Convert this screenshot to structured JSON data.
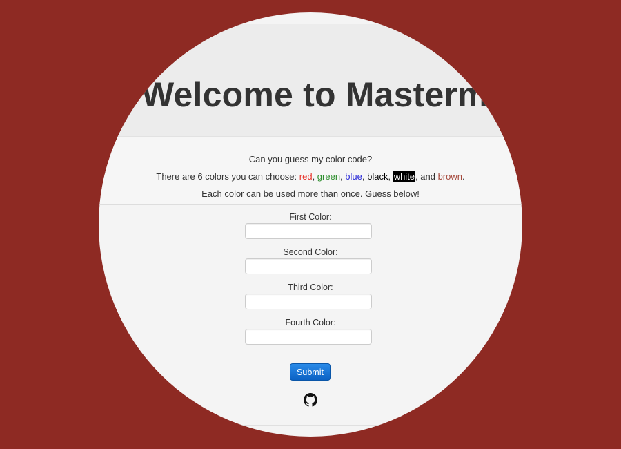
{
  "colors": {
    "background": "#8e2a23",
    "panel": "#f4f4f4",
    "jumbotron": "#ececec",
    "submit": "#1f78d1"
  },
  "header": {
    "title": "Welcome to Mastermind"
  },
  "intro": {
    "question": "Can you guess my color code?",
    "colors_prefix": "There are 6 colors you can choose: ",
    "color_names": {
      "red": "red",
      "green": "green",
      "blue": "blue",
      "black": "black",
      "white": "white",
      "brown": "brown"
    },
    "sep": ", ",
    "and": ", and ",
    "end": ".",
    "rule": "Each color can be used more than once. Guess below!"
  },
  "form": {
    "fields": [
      {
        "label": "First Color:",
        "value": ""
      },
      {
        "label": "Second Color:",
        "value": ""
      },
      {
        "label": "Third Color:",
        "value": ""
      },
      {
        "label": "Fourth Color:",
        "value": ""
      }
    ],
    "submit_label": "Submit"
  },
  "footer": {
    "icon": "github-icon"
  }
}
